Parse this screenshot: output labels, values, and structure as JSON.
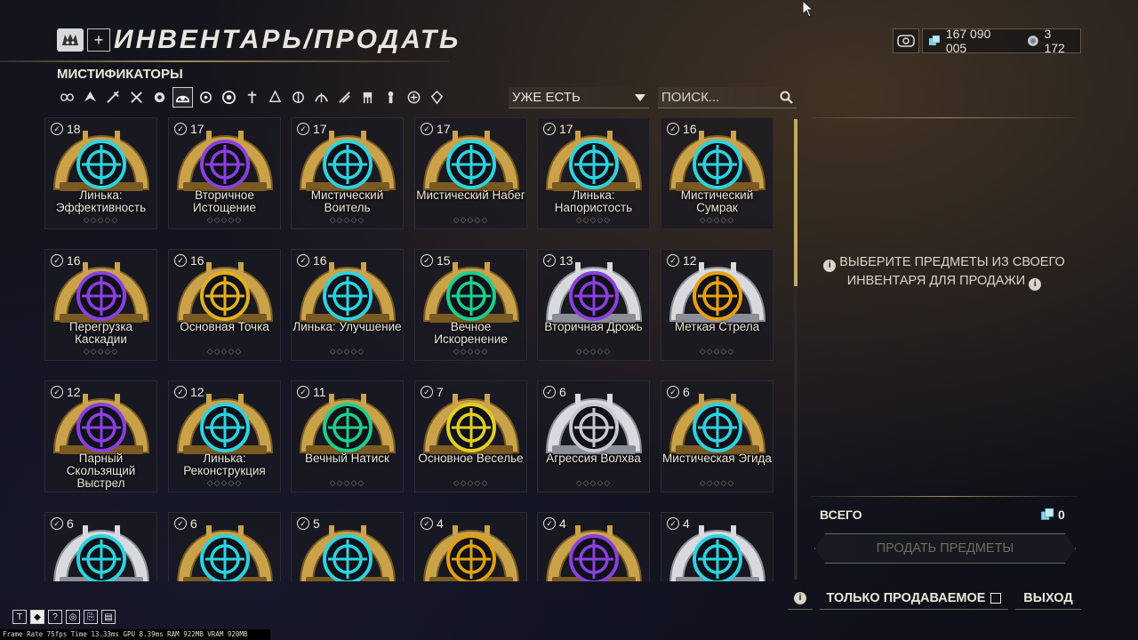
{
  "header": {
    "title": "ИНВЕНТАРЬ/ПРОДАТЬ",
    "section": "МИСТИФИКАТОРЫ",
    "plus": "+"
  },
  "currency": {
    "credits": "167 090 005",
    "platinum": "3 172"
  },
  "filters": {
    "icons": [
      "all-icon",
      "warframe-icon",
      "primary-icon",
      "secondary-icon",
      "melee-icon",
      "arcane-icon",
      "companion-icon",
      "mod-icon",
      "relic-icon",
      "gear-icon",
      "sentinel-icon",
      "archwing-icon",
      "resource-icon",
      "fish-icon",
      "key-icon",
      "misc-icon",
      "sigil-icon"
    ],
    "active_index": 5,
    "dropdown_value": "УЖЕ ЕСТЬ",
    "search_placeholder": "ПОИСК..."
  },
  "items": [
    {
      "count": "18",
      "name": "Линька: Эффективность",
      "color": "#2ad4e0",
      "frame": "gold",
      "rank": "◇◇◇◇◇"
    },
    {
      "count": "17",
      "name": "Вторичное Истощение",
      "color": "#8a3fe0",
      "frame": "gold",
      "rank": "◇◇◇◇◇"
    },
    {
      "count": "17",
      "name": "Мистический Воитель",
      "color": "#2ad4e0",
      "frame": "gold",
      "rank": "◇◇◇◇◇"
    },
    {
      "count": "17",
      "name": "Мистический Набег",
      "color": "#2ad4e0",
      "frame": "gold",
      "rank": "◇◇◇◇◇"
    },
    {
      "count": "17",
      "name": "Линька: Напористость",
      "color": "#2ad4e0",
      "frame": "gold",
      "rank": "◇◇◇◇◇"
    },
    {
      "count": "16",
      "name": "Мистический Сумрак",
      "color": "#2ad4e0",
      "frame": "gold",
      "rank": "◇◇◇◇◇"
    },
    {
      "count": "16",
      "name": "Перегрузка Каскадии",
      "color": "#8a3fe0",
      "frame": "gold",
      "rank": "◇◇◇◇◇"
    },
    {
      "count": "16",
      "name": "Основная Точка",
      "color": "#e0b020",
      "frame": "gold",
      "rank": "◇◇◇◇◇"
    },
    {
      "count": "16",
      "name": "Линька: Улучшение",
      "color": "#2ad4e0",
      "frame": "gold",
      "rank": "◇◇◇◇◇"
    },
    {
      "count": "15",
      "name": "Вечное Искоренение",
      "color": "#1ad08a",
      "frame": "gold",
      "rank": "◇◇◇◇◇"
    },
    {
      "count": "13",
      "name": "Вторичная Дрожь",
      "color": "#8a3fe0",
      "frame": "silver",
      "rank": "◇◇◇◇◇"
    },
    {
      "count": "12",
      "name": "Меткая Стрела",
      "color": "#e8a010",
      "frame": "silver",
      "rank": "◇◇◇◇◇"
    },
    {
      "count": "12",
      "name": "Парный Скользящий Выстрел",
      "color": "#8a3fe0",
      "frame": "gold",
      "rank": "◇◇◇◇◇"
    },
    {
      "count": "12",
      "name": "Линька: Реконструкция",
      "color": "#2ad4e0",
      "frame": "gold",
      "rank": "◇◇◇◇◇"
    },
    {
      "count": "11",
      "name": "Вечный Натиск",
      "color": "#1ad08a",
      "frame": "gold",
      "rank": "◇◇◇◇◇"
    },
    {
      "count": "7",
      "name": "Основное Веселье",
      "color": "#e0d020",
      "frame": "gold",
      "rank": "◇◇◇◇◇"
    },
    {
      "count": "6",
      "name": "Агрессия Волхва",
      "color": "#c8c8d0",
      "frame": "silver",
      "rank": "◇◇◇◇◇"
    },
    {
      "count": "6",
      "name": "Мистическая Эгида",
      "color": "#2ad4e0",
      "frame": "gold",
      "rank": "◇◇◇◇◇"
    },
    {
      "count": "6",
      "name": "",
      "color": "#2ad4e0",
      "frame": "silver",
      "rank": ""
    },
    {
      "count": "6",
      "name": "",
      "color": "#2ad4e0",
      "frame": "gold",
      "rank": ""
    },
    {
      "count": "5",
      "name": "",
      "color": "#2ad4e0",
      "frame": "gold",
      "rank": ""
    },
    {
      "count": "4",
      "name": "",
      "color": "#e0a010",
      "frame": "gold",
      "rank": ""
    },
    {
      "count": "4",
      "name": "",
      "color": "#8a3fe0",
      "frame": "gold",
      "rank": ""
    },
    {
      "count": "4",
      "name": "",
      "color": "#2ad4e0",
      "frame": "silver",
      "rank": ""
    }
  ],
  "panel": {
    "hint": "ВЫБЕРИТЕ ПРЕДМЕТЫ ИЗ СВОЕГО ИНВЕНТАРЯ ДЛЯ ПРОДАЖИ",
    "total_label": "ВСЕГО",
    "total_value": "0",
    "sell_label": "ПРОДАТЬ ПРЕДМЕТЫ",
    "only_sellable": "ТОЛЬКО ПРОДАВАЕМОЕ",
    "exit": "ВЫХОД",
    "info_glyph": "i"
  },
  "debug": {
    "icons": [
      "T",
      "◆",
      "?",
      "◎",
      "⎘",
      "▤"
    ],
    "stats": "Frame Rate 75fps Time 13.33ms GPU 8.39ms RAM 922MB VRAM 920MB"
  }
}
